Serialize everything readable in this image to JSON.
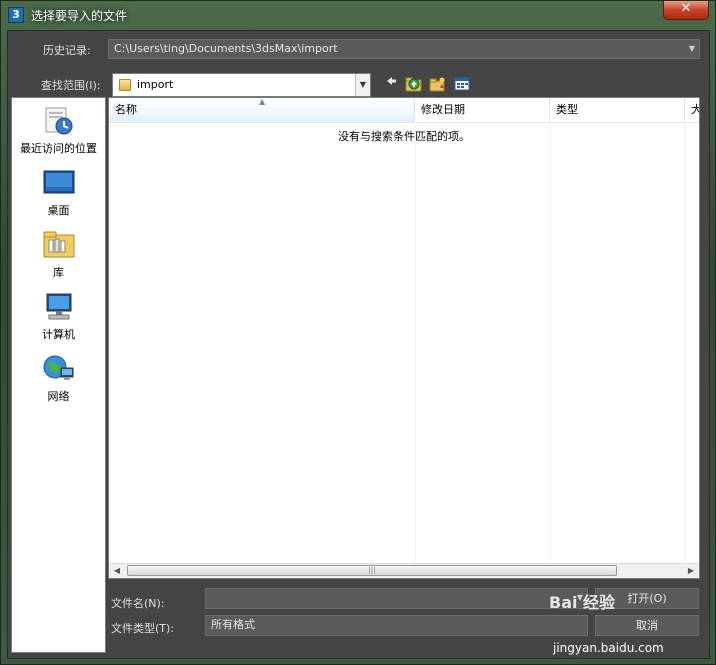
{
  "window": {
    "title": "选择要导入的文件",
    "icon_text": "3",
    "close_glyph": "✕"
  },
  "history": {
    "label": "历史记录:",
    "value": "C:\\Users\\ting\\Documents\\3dsMax\\import"
  },
  "look_in": {
    "label": "查找范围(I):",
    "value": "import"
  },
  "toolbar": {
    "back_icon": "back-arrow-icon",
    "up_icon": "up-folder-icon",
    "new_folder_icon": "new-folder-icon",
    "view_menu_icon": "view-menu-icon"
  },
  "places": [
    {
      "label": "最近访问的位置",
      "icon": "recent-places-icon"
    },
    {
      "label": "桌面",
      "icon": "desktop-icon"
    },
    {
      "label": "库",
      "icon": "libraries-icon"
    },
    {
      "label": "计算机",
      "icon": "computer-icon"
    },
    {
      "label": "网络",
      "icon": "network-icon"
    }
  ],
  "columns": [
    {
      "label": "名称"
    },
    {
      "label": "修改日期"
    },
    {
      "label": "类型"
    },
    {
      "label": "大"
    }
  ],
  "empty_message": "没有与搜索条件匹配的项。",
  "file_name": {
    "label": "文件名(N):",
    "value": ""
  },
  "file_type": {
    "label": "文件类型(T):",
    "value": "所有格式"
  },
  "buttons": {
    "open": "打开(O)",
    "cancel": "取消"
  },
  "watermark": {
    "brand": "Bai 经验",
    "url": "jingyan.baidu.com"
  },
  "colors": {
    "client_bg": "#454545",
    "list_bg": "#ffffff",
    "header_active": "#e5f1fb",
    "glass_green": "#3c5a3c"
  }
}
